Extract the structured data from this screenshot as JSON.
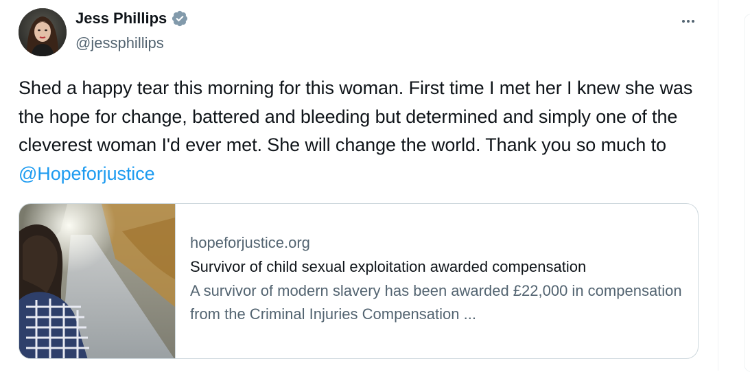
{
  "author": {
    "name": "Jess Phillips",
    "handle": "@jessphillips",
    "verified": true
  },
  "tweet": {
    "text": "Shed a happy tear this morning for this woman. First time I met her I knew she was the hope for change, battered and bleeding but determined and simply one of the cleverest woman I'd ever met. She will change the world. Thank you so much to ",
    "mention": "@Hopeforjustice"
  },
  "link_card": {
    "domain": "hopeforjustice.org",
    "title": "Survivor of child sexual exploitation awarded compensation",
    "description": "A survivor of modern slavery has been awarded £22,000 in compensation from the Criminal Injuries Compensation ..."
  },
  "icons": {
    "verified": "verified-badge-icon",
    "more": "more-options-icon"
  },
  "colors": {
    "mention": "#1d9bf0",
    "secondary_text": "#536471",
    "border": "#cfd9de"
  }
}
